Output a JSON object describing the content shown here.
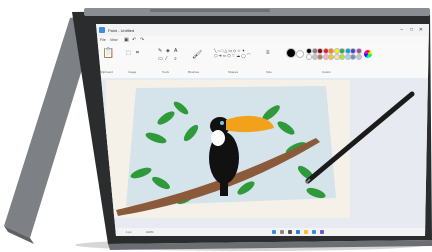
{
  "paint": {
    "title": "Paint - Untitled",
    "menu": [
      "File",
      "View"
    ],
    "groups": [
      "Clipboard",
      "Image",
      "Tools",
      "Brushes",
      "Shapes",
      "Size",
      "Colors"
    ],
    "status": [
      "1 px",
      "100%"
    ]
  },
  "colors": {
    "device_body": "#7a7d80",
    "device_edge": "#5a5d60",
    "bezel": "#1f2123",
    "canvas_bg": "#f6f1e8",
    "sky": "#cfe1ea",
    "leaf": "#2e9a3a",
    "branch": "#8b5a3a",
    "toucan_body": "#111111",
    "toucan_beak": "#f2a21a",
    "pen": "#1b1b1b"
  },
  "palette": [
    "#000000",
    "#7f7f7f",
    "#880015",
    "#ed1c24",
    "#ff7f27",
    "#fff200",
    "#22b14c",
    "#00a2e8",
    "#3f48cc",
    "#a349a4",
    "#ffffff",
    "#c3c3c3",
    "#b97a57",
    "#ffaec9",
    "#ffc90e",
    "#efe4b0",
    "#b5e61d",
    "#99d9ea",
    "#7092be",
    "#c8bfe7"
  ],
  "icons": {
    "pencil": "pencil-icon",
    "fill": "fill-icon",
    "text": "text-icon",
    "eraser": "eraser-icon",
    "picker": "color-picker-icon",
    "zoom": "zoom-icon",
    "brush": "brush-icon",
    "minimize": "minimize-icon",
    "maximize": "maximize-icon",
    "close": "close-icon"
  }
}
